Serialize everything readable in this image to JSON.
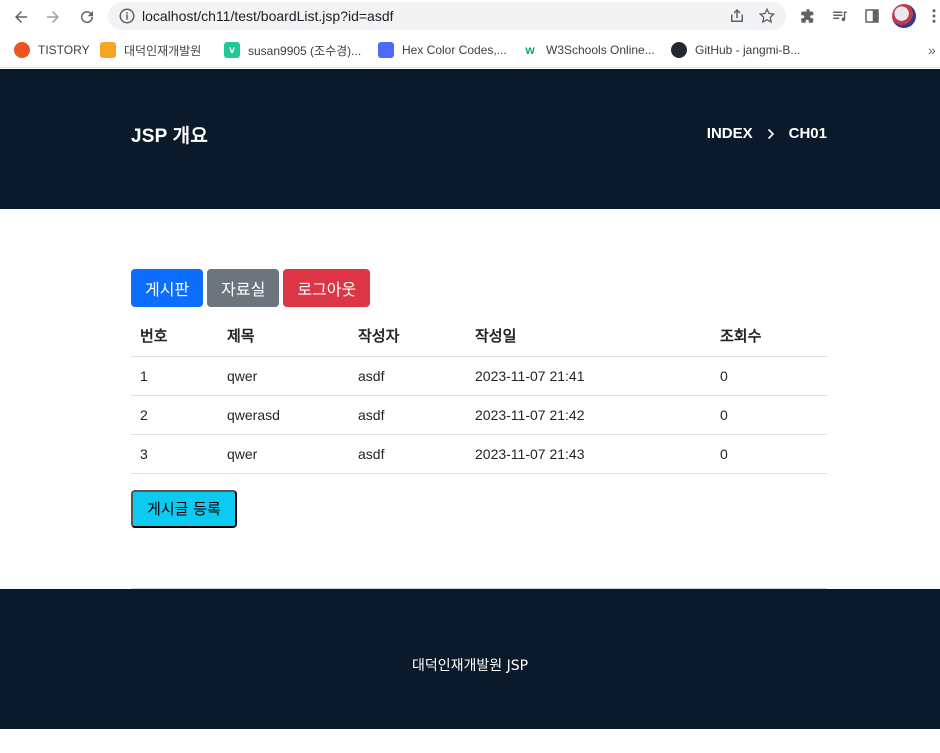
{
  "browser": {
    "url": "localhost/ch11/test/boardList.jsp?id=asdf",
    "bookmarks": [
      {
        "label": "TISTORY",
        "color": "#eb531f"
      },
      {
        "label": "대덕인재개발원",
        "color": "#f5a623"
      },
      {
        "label": "susan9905 (조수경)...",
        "color": "#20c997"
      },
      {
        "label": "Hex Color Codes,...",
        "color": "#4a6cf7"
      },
      {
        "label": "W3Schools Online...",
        "color": "#04aa6d"
      },
      {
        "label": "GitHub - jangmi-B...",
        "color": "#24292f"
      }
    ],
    "more": "»"
  },
  "header": {
    "title": "JSP 개요",
    "breadcrumb": [
      "INDEX",
      "CH01"
    ]
  },
  "menu": {
    "board": "게시판",
    "data_room": "자료실",
    "logout": "로그아웃"
  },
  "table": {
    "columns": [
      "번호",
      "제목",
      "작성자",
      "작성일",
      "조회수"
    ],
    "rows": [
      [
        "1",
        "qwer",
        "asdf",
        "2023-11-07 21:41",
        "0"
      ],
      [
        "2",
        "qwerasd",
        "asdf",
        "2023-11-07 21:42",
        "0"
      ],
      [
        "3",
        "qwer",
        "asdf",
        "2023-11-07 21:43",
        "0"
      ]
    ]
  },
  "write_button": "게시글 등록",
  "footer": {
    "text": "대덕인재개발원 JSP"
  },
  "colors": {
    "header_bg": "#0b1a2b",
    "primary": "#0d6efd",
    "secondary": "#6c757d",
    "danger": "#dc3545",
    "info": "#0dcaf0"
  }
}
